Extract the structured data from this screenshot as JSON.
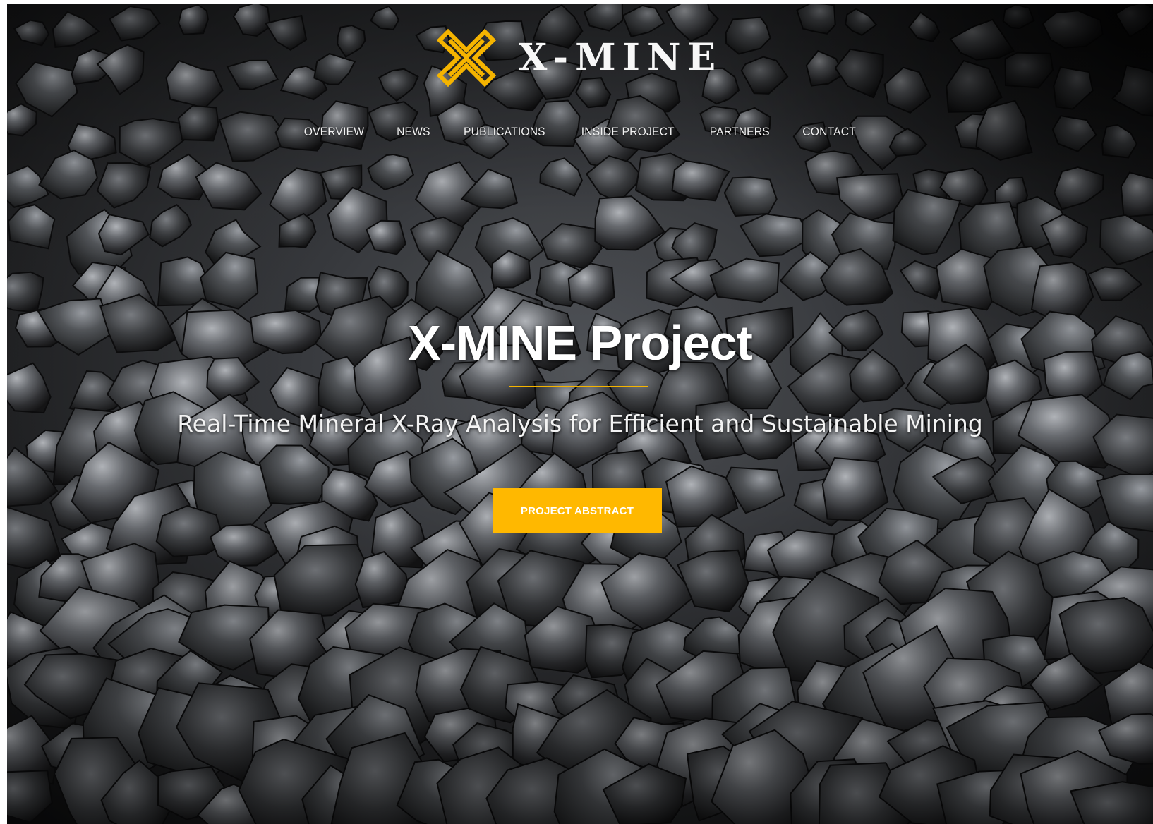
{
  "brand": {
    "name": "X-MINE",
    "logo_icon": "x-mine-emblem-icon",
    "accent_color": "#f5b400",
    "logo_text_color": "#f7f7f7"
  },
  "nav": {
    "items": [
      {
        "label": "OVERVIEW"
      },
      {
        "label": "NEWS"
      },
      {
        "label": "PUBLICATIONS"
      },
      {
        "label": "INSIDE PROJECT"
      },
      {
        "label": "PARTNERS"
      },
      {
        "label": "CONTACT"
      }
    ]
  },
  "hero": {
    "title": "X-MINE Project",
    "subtitle": "Real-Time Mineral X-Ray Analysis for Efficient and Sustainable Mining",
    "cta_label": "PROJECT ABSTRACT",
    "cta_color": "#ffb800",
    "background": "dark mineral ore rocks photo"
  }
}
